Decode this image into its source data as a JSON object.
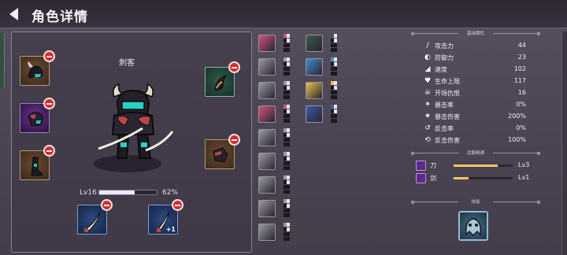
{
  "header": {
    "title": "角色详情",
    "back_icon": "back-arrow-icon"
  },
  "character": {
    "name": "刺客",
    "level_label": "Lv16",
    "xp_fraction": 0.62,
    "xp_percent": "62%"
  },
  "equipment_left": [
    {
      "name": "helmet-slot",
      "rarity": "brown",
      "icon": "horned-helmet-icon"
    },
    {
      "name": "armor-slot",
      "rarity": "purple",
      "icon": "armor-icon"
    },
    {
      "name": "boots-slot",
      "rarity": "brown",
      "icon": "boots-icon"
    }
  ],
  "equipment_right": [
    {
      "name": "amulet-slot",
      "rarity": "green",
      "icon": "horn-icon"
    },
    {
      "name": "gloves-slot",
      "rarity": "brown",
      "icon": "gauntlet-icon"
    }
  ],
  "weapons": [
    {
      "name": "weapon-slot-1",
      "icon": "curved-blade-icon",
      "plus": ""
    },
    {
      "name": "weapon-slot-2",
      "icon": "dagger-icon",
      "plus": "+1"
    }
  ],
  "inventory_col1": [
    {
      "color": "#d2537c"
    },
    {
      "color": "#9a9aa0"
    },
    {
      "color": "#9a9aa0"
    },
    {
      "color": "#d2537c"
    },
    {
      "color": "#9a9aa0"
    },
    {
      "color": "#9a9aa0"
    },
    {
      "color": "#9a9aa0"
    },
    {
      "color": "#9a9aa0"
    },
    {
      "color": "#9a9aa0"
    }
  ],
  "inventory_col2": [
    {
      "color": "#3a5a4a"
    },
    {
      "color": "#3b8fd1"
    },
    {
      "color": "#e6c24a"
    },
    {
      "color": "#3b5aa6"
    }
  ],
  "sections": {
    "attributes": "基础属性",
    "weapon_mastery": "武器精通",
    "skills": "技能"
  },
  "stats": [
    {
      "icon": "sword-icon",
      "label": "攻击力",
      "value": "44"
    },
    {
      "icon": "shield-icon",
      "label": "防御力",
      "value": "23"
    },
    {
      "icon": "boot-icon",
      "label": "速度",
      "value": "102"
    },
    {
      "icon": "heart-icon",
      "label": "生命上限",
      "value": "117"
    },
    {
      "icon": "skull-icon",
      "label": "开场仇恨",
      "value": "16"
    },
    {
      "icon": "crit-icon",
      "label": "暴击率",
      "value": "0%"
    },
    {
      "icon": "crit-damage-icon",
      "label": "暴击伤害",
      "value": "200%"
    },
    {
      "icon": "counter-icon",
      "label": "反击率",
      "value": "0%"
    },
    {
      "icon": "counter-damage-icon",
      "label": "反击伤害",
      "value": "100%"
    }
  ],
  "mastery": [
    {
      "icon": "blade-icon",
      "label": "刀",
      "fill": 0.75,
      "level": "Lv3"
    },
    {
      "icon": "sword-mastery-icon",
      "label": "剑",
      "fill": 0.25,
      "level": "Lv1"
    }
  ],
  "skill": {
    "icon": "ghost-skill-icon"
  }
}
